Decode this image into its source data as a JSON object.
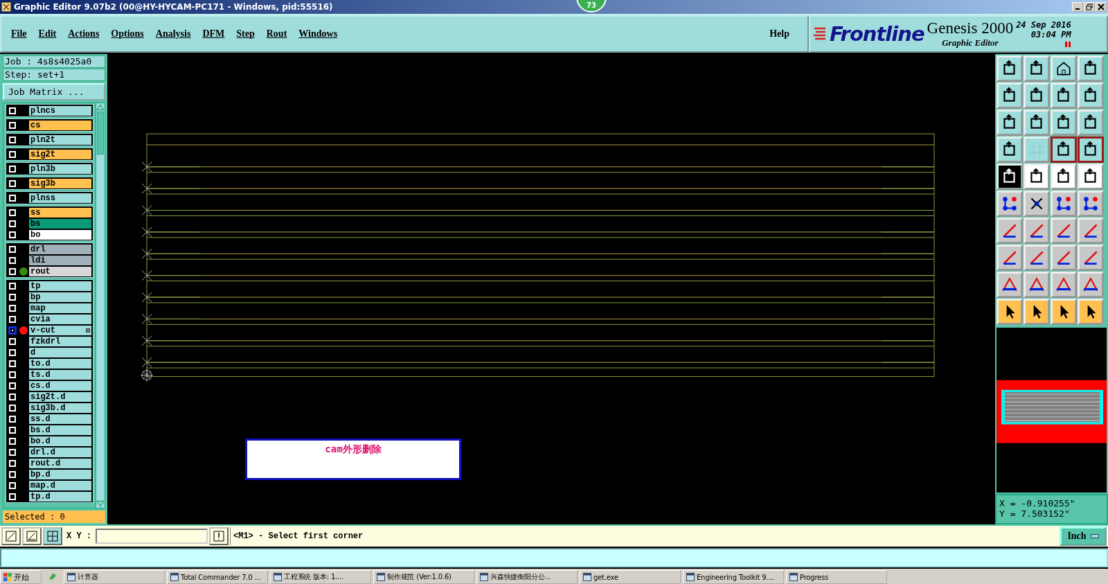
{
  "window": {
    "title": "Graphic Editor 9.07b2 (00@HY-HYCAM-PC171 - Windows, pid:55516)"
  },
  "badge": "73",
  "menu": [
    "File",
    "Edit",
    "Actions",
    "Options",
    "Analysis",
    "DFM",
    "Step",
    "Rout",
    "Windows"
  ],
  "help": "Help",
  "brand": {
    "logo": "Frontline",
    "product": "Genesis 2000",
    "subtitle": "Graphic Editor",
    "date": "24 Sep 2016",
    "time": "03:04 PM"
  },
  "job": {
    "job": "Job : 4s8s4025a0",
    "step": "Step: set+1",
    "matrix_button": "Job Matrix ..."
  },
  "layer_groups": [
    {
      "layers": [
        {
          "name": "plncs",
          "color": "#9fdcdc",
          "selected": false
        }
      ]
    },
    {
      "layers": [
        {
          "name": "cs",
          "color": "#ffc050",
          "selected": false
        }
      ]
    },
    {
      "layers": [
        {
          "name": "pln2t",
          "color": "#9fdcdc",
          "selected": false
        }
      ]
    },
    {
      "layers": [
        {
          "name": "sig2t",
          "color": "#ffc050",
          "selected": false
        }
      ]
    },
    {
      "layers": [
        {
          "name": "pln3b",
          "color": "#9fdcdc",
          "selected": false
        }
      ]
    },
    {
      "layers": [
        {
          "name": "sig3b",
          "color": "#ffc050",
          "selected": false
        }
      ]
    },
    {
      "layers": [
        {
          "name": "plnss",
          "color": "#9fdcdc",
          "selected": false
        }
      ]
    },
    {
      "layers": [
        {
          "name": "ss",
          "color": "#ffc050",
          "selected": false
        },
        {
          "name": "bs",
          "color": "#0a9a78",
          "selected": false
        },
        {
          "name": "bo",
          "color": "#ffffff",
          "selected": false
        }
      ]
    },
    {
      "layers": [
        {
          "name": "drl",
          "color": "#a0b0b8",
          "selected": false
        },
        {
          "name": "ldi",
          "color": "#a0b0b8",
          "selected": false
        },
        {
          "name": "rout",
          "color": "#d8d8d8",
          "selected": false,
          "dot": {
            "color": "#3a8a10"
          }
        }
      ]
    },
    {
      "layers": [
        {
          "name": "tp",
          "color": "#9fdcdc",
          "selected": false
        },
        {
          "name": "bp",
          "color": "#9fdcdc",
          "selected": false
        },
        {
          "name": "map",
          "color": "#9fdcdc",
          "selected": false
        },
        {
          "name": "cvia",
          "color": "#9fdcdc",
          "selected": false
        },
        {
          "name": "v-cut",
          "color": "#9fdcdc",
          "selected": true,
          "dot": {
            "color": "#ff1010"
          }
        },
        {
          "name": "fzkdrl",
          "color": "#9fdcdc",
          "selected": false
        },
        {
          "name": "d",
          "color": "#9fdcdc",
          "selected": false
        },
        {
          "name": "to.d",
          "color": "#9fdcdc",
          "selected": false
        },
        {
          "name": "ts.d",
          "color": "#9fdcdc",
          "selected": false
        },
        {
          "name": "cs.d",
          "color": "#9fdcdc",
          "selected": false
        },
        {
          "name": "sig2t.d",
          "color": "#9fdcdc",
          "selected": false
        },
        {
          "name": "sig3b.d",
          "color": "#9fdcdc",
          "selected": false
        },
        {
          "name": "ss.d",
          "color": "#9fdcdc",
          "selected": false
        },
        {
          "name": "bs.d",
          "color": "#9fdcdc",
          "selected": false
        },
        {
          "name": "bo.d",
          "color": "#9fdcdc",
          "selected": false
        },
        {
          "name": "drl.d",
          "color": "#9fdcdc",
          "selected": false
        },
        {
          "name": "rout.d",
          "color": "#9fdcdc",
          "selected": false
        },
        {
          "name": "bp.d",
          "color": "#9fdcdc",
          "selected": false
        },
        {
          "name": "map.d",
          "color": "#9fdcdc",
          "selected": false
        },
        {
          "name": "tp.d",
          "color": "#9fdcdc",
          "selected": false
        }
      ]
    }
  ],
  "selected_count": "Selected : 0",
  "canvas": {
    "note": "cam外形删除"
  },
  "coords": {
    "x": "X = -0.910255\"",
    "y": "Y = 7.503152\""
  },
  "command": {
    "label": "X Y :",
    "prompt": "<M1> - Select first corner",
    "units": "Inch"
  },
  "taskbar": {
    "start": "开始",
    "items": [
      "计算器",
      "Total Commander 7.0 ...",
      "工程系统  版本: 1....",
      "制作规范 (Ver:1.0.6)",
      "兴森快捷衡阳分公...",
      "get.exe",
      "Engineering Toolkit 9....",
      "Progress"
    ]
  }
}
